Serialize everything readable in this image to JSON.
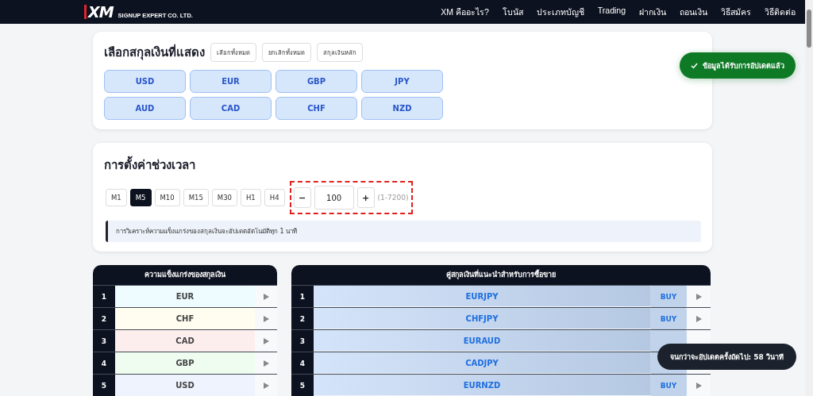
{
  "header": {
    "logo": "XM",
    "brand": "SIGNUP EXPERT CO. LTD.",
    "nav": [
      "XM คืออะไร?",
      "โบนัส",
      "ประเภทบัญชี",
      "Trading",
      "ฝากเงิน",
      "ถอนเงิน",
      "วิธีสมัคร",
      "วิธีติดต่อ"
    ]
  },
  "currency_select": {
    "title": "เลือกสกุลเงินที่แสดง",
    "actions": [
      "เลือกทั้งหมด",
      "ยกเลิกทั้งหมด",
      "สกุลเงินหลัก"
    ],
    "currencies": [
      {
        "label": "USD",
        "selected": true
      },
      {
        "label": "EUR",
        "selected": true
      },
      {
        "label": "GBP",
        "selected": true
      },
      {
        "label": "JPY",
        "selected": true
      },
      {
        "label": "AUD",
        "selected": true
      },
      {
        "label": "CAD",
        "selected": true
      },
      {
        "label": "CHF",
        "selected": true
      },
      {
        "label": "NZD",
        "selected": true
      }
    ]
  },
  "timeframe": {
    "title": "การตั้งค่าช่วงเวลา",
    "options": [
      {
        "label": "M1",
        "selected": false
      },
      {
        "label": "M5",
        "selected": true
      },
      {
        "label": "M10",
        "selected": false
      },
      {
        "label": "M15",
        "selected": false
      },
      {
        "label": "M30",
        "selected": false
      },
      {
        "label": "H1",
        "selected": false
      },
      {
        "label": "H4",
        "selected": false
      }
    ],
    "stepper": {
      "minus": "−",
      "value": "100",
      "plus": "+",
      "range": "(1-7200)"
    },
    "info": "การวิเคราะห์ความแข็งแกร่งของสกุลเงินจะอัปเดตอัตโนมัติทุก 1 นาที"
  },
  "strength_table": {
    "title": "ความแข็งแกร่งของสกุลเงิน",
    "rows": [
      {
        "rank": "1",
        "currency": "EUR",
        "color": "#eefcff"
      },
      {
        "rank": "2",
        "currency": "CHF",
        "color": "#fffdf0"
      },
      {
        "rank": "3",
        "currency": "CAD",
        "color": "#fdeeee"
      },
      {
        "rank": "4",
        "currency": "GBP",
        "color": "#effdf0"
      },
      {
        "rank": "5",
        "currency": "USD",
        "color": "#eef3fd"
      }
    ]
  },
  "pairs_table": {
    "title": "คู่สกุลเงินที่แนะนำสำหรับการซื้อขาย",
    "rows": [
      {
        "rank": "1",
        "pair": "EURJPY",
        "signal": "BUY"
      },
      {
        "rank": "2",
        "pair": "CHFJPY",
        "signal": "BUY"
      },
      {
        "rank": "3",
        "pair": "EURAUD"
      },
      {
        "rank": "4",
        "pair": "CADJPY"
      },
      {
        "rank": "5",
        "pair": "EURNZD",
        "signal": "BUY"
      }
    ]
  },
  "toasts": [
    {
      "kind": "success",
      "text": "ข้อมูลได้รับการอัปเดตแล้ว"
    },
    {
      "kind": "timer",
      "text": "จนกว่าจะอัปเดตครั้งถัดไป: 58 วินาที"
    }
  ]
}
